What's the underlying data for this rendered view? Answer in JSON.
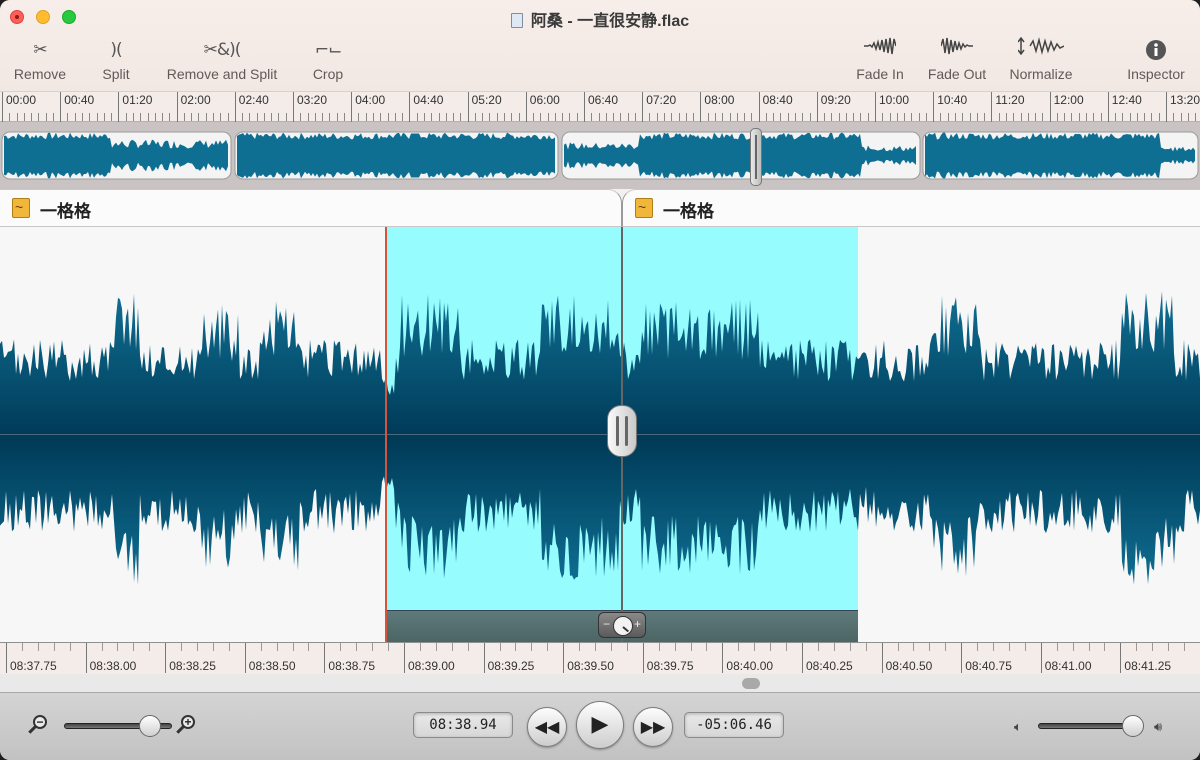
{
  "window": {
    "title": "阿桑 - 一直很安静.flac"
  },
  "toolbar": {
    "remove": {
      "label": "Remove",
      "icon": "scissors-icon"
    },
    "split": {
      "label": "Split",
      "icon": "split-icon"
    },
    "remove_split": {
      "label": "Remove and Split",
      "icon": "remove-and-split-icon"
    },
    "crop": {
      "label": "Crop",
      "icon": "crop-icon"
    },
    "fade_in": {
      "label": "Fade In",
      "icon": "fade-in-icon"
    },
    "fade_out": {
      "label": "Fade Out",
      "icon": "fade-out-icon"
    },
    "normalize": {
      "label": "Normalize",
      "icon": "normalize-icon"
    },
    "inspector": {
      "label": "Inspector",
      "icon": "info-icon"
    }
  },
  "top_ruler": {
    "labels": [
      "00:00",
      "00:40",
      "01:20",
      "02:00",
      "02:40",
      "03:20",
      "04:00",
      "04:40",
      "05:20",
      "06:00",
      "06:40",
      "07:20",
      "08:00",
      "08:40",
      "09:20",
      "10:00",
      "10:40",
      "11:20",
      "12:00",
      "12:40",
      "13:20"
    ]
  },
  "tracks": [
    {
      "label": "一格格"
    },
    {
      "label": "一格格"
    }
  ],
  "bottom_ruler": {
    "labels": [
      "08:37.75",
      "08:38.00",
      "08:38.25",
      "08:38.50",
      "08:38.75",
      "08:39.00",
      "08:39.25",
      "08:39.50",
      "08:39.75",
      "08:40.00",
      "08:40.25",
      "08:40.50",
      "08:40.75",
      "08:41.00",
      "08:41.25"
    ]
  },
  "transport": {
    "current_time": "08:38.94",
    "remaining_time": "-05:06.46",
    "rewind_icon": "rewind-icon",
    "play_icon": "play-icon",
    "forward_icon": "fast-forward-icon",
    "zoom_level": 0.8,
    "volume_level": 0.95
  },
  "colors": {
    "waveform": "#0f6f93",
    "waveform_dark": "#003a57",
    "selection": "#96fcfd",
    "selection_start_line": "#d9533a"
  }
}
